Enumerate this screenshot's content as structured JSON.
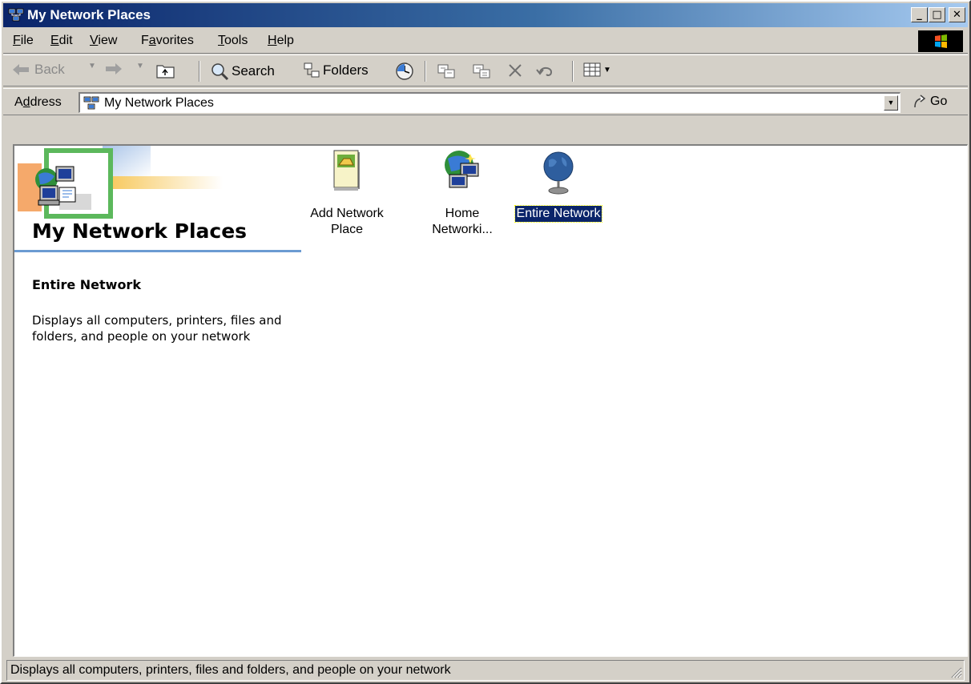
{
  "window": {
    "title": "My Network Places",
    "icon": "network-places-icon"
  },
  "menu": {
    "items": [
      {
        "label": "File",
        "mnemonic": "F",
        "rest": "ile"
      },
      {
        "label": "Edit",
        "mnemonic": "E",
        "rest": "dit"
      },
      {
        "label": "View",
        "mnemonic": "V",
        "rest": "iew"
      },
      {
        "label": "Favorites",
        "pre": "F",
        "mnemonic": "a",
        "rest": "vorites"
      },
      {
        "label": "Tools",
        "mnemonic": "T",
        "rest": "ools"
      },
      {
        "label": "Help",
        "mnemonic": "H",
        "rest": "elp"
      }
    ]
  },
  "toolbar": {
    "back_label": "Back",
    "search_label": "Search",
    "folders_label": "Folders"
  },
  "address": {
    "label_pre": "A",
    "label_mnemonic": "d",
    "label_rest": "dress",
    "value": "My Network Places",
    "go_label": "Go"
  },
  "panel": {
    "heading": "My Network Places",
    "selected_title": "Entire Network",
    "selected_description": "Displays all computers, printers, files and folders, and people on your network"
  },
  "items": [
    {
      "line1": "Add Network",
      "line2": "Place",
      "icon": "add-network-place-icon"
    },
    {
      "line1": "Home",
      "line2": "Networki...",
      "icon": "home-networking-icon"
    },
    {
      "line1": "Entire Network",
      "line2": "",
      "icon": "entire-network-globe-icon",
      "selected": true
    }
  ],
  "status": {
    "text": "Displays all computers, printers, files and folders, and people on your network"
  },
  "colors": {
    "title_bar_start": "#0a246a",
    "title_bar_end": "#a6caf0",
    "selection": "#0a246a",
    "chrome": "#d4d0c8"
  }
}
